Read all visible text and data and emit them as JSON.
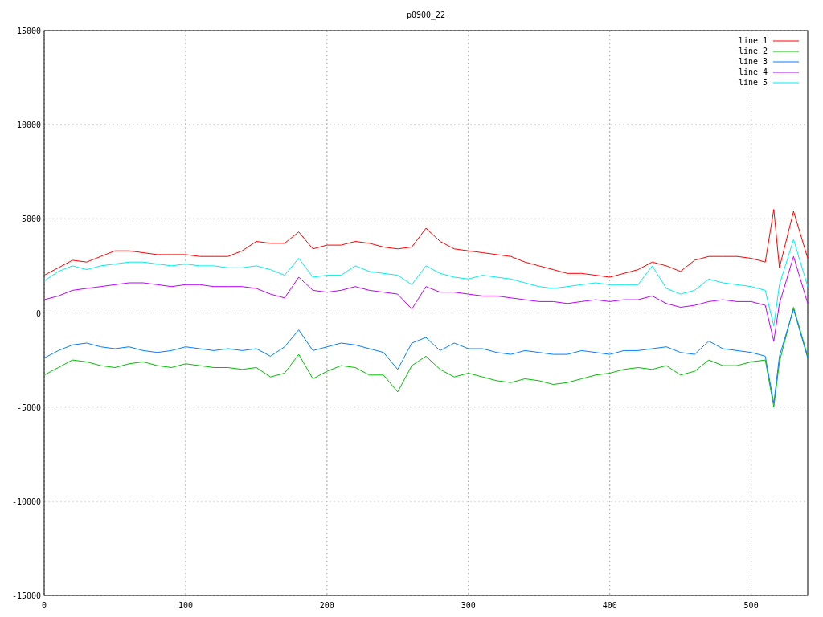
{
  "chart": {
    "chart_data": {
      "type": "line",
      "title": "p0900_22",
      "x": [
        0,
        10,
        20,
        30,
        40,
        50,
        60,
        70,
        80,
        90,
        100,
        110,
        120,
        130,
        140,
        150,
        160,
        170,
        180,
        190,
        200,
        210,
        220,
        230,
        240,
        250,
        260,
        270,
        280,
        290,
        300,
        310,
        320,
        330,
        340,
        350,
        360,
        370,
        380,
        390,
        400,
        410,
        420,
        430,
        440,
        450,
        460,
        470,
        480,
        490,
        500,
        510,
        516,
        520,
        530,
        540
      ],
      "series": [
        {
          "name": "line 1",
          "color": "#ff0000",
          "values": [
            2000,
            2400,
            2800,
            2700,
            3000,
            3300,
            3300,
            3200,
            3100,
            3100,
            3100,
            3000,
            3000,
            3000,
            3300,
            3800,
            3700,
            3700,
            4300,
            3400,
            3600,
            3600,
            3800,
            3700,
            3500,
            3400,
            3500,
            4500,
            3800,
            3400,
            3300,
            3200,
            3100,
            3000,
            2700,
            2500,
            2300,
            2100,
            2100,
            2000,
            1900,
            2100,
            2300,
            2700,
            2500,
            2200,
            2800,
            3000,
            3000,
            3000,
            2900,
            2700,
            5500,
            2400,
            5400,
            2900
          ]
        },
        {
          "name": "line 2",
          "color": "#00c000",
          "values": [
            -3300,
            -2900,
            -2500,
            -2600,
            -2800,
            -2900,
            -2700,
            -2600,
            -2800,
            -2900,
            -2700,
            -2800,
            -2900,
            -2900,
            -3000,
            -2900,
            -3400,
            -3200,
            -2200,
            -3500,
            -3100,
            -2800,
            -2900,
            -3300,
            -3300,
            -4200,
            -2800,
            -2300,
            -3000,
            -3400,
            -3200,
            -3400,
            -3600,
            -3700,
            -3500,
            -3600,
            -3800,
            -3700,
            -3500,
            -3300,
            -3200,
            -3000,
            -2900,
            -3000,
            -2800,
            -3300,
            -3100,
            -2500,
            -2800,
            -2800,
            -2600,
            -2500,
            -5000,
            -2600,
            300,
            -2300
          ]
        },
        {
          "name": "line 3",
          "color": "#0080ff",
          "values": [
            -2400,
            -2000,
            -1700,
            -1600,
            -1800,
            -1900,
            -1800,
            -2000,
            -2100,
            -2000,
            -1800,
            -1900,
            -2000,
            -1900,
            -2000,
            -1900,
            -2300,
            -1800,
            -900,
            -2000,
            -1800,
            -1600,
            -1700,
            -1900,
            -2100,
            -3000,
            -1600,
            -1300,
            -2000,
            -1600,
            -1900,
            -1900,
            -2100,
            -2200,
            -2000,
            -2100,
            -2200,
            -2200,
            -2000,
            -2100,
            -2200,
            -2000,
            -2000,
            -1900,
            -1800,
            -2100,
            -2200,
            -1500,
            -1900,
            -2000,
            -2100,
            -2300,
            -4800,
            -2300,
            200,
            -2400
          ]
        },
        {
          "name": "line 4",
          "color": "#c000ff",
          "values": [
            700,
            900,
            1200,
            1300,
            1400,
            1500,
            1600,
            1600,
            1500,
            1400,
            1500,
            1500,
            1400,
            1400,
            1400,
            1300,
            1000,
            800,
            1900,
            1200,
            1100,
            1200,
            1400,
            1200,
            1100,
            1000,
            200,
            1400,
            1100,
            1100,
            1000,
            900,
            900,
            800,
            700,
            600,
            600,
            500,
            600,
            700,
            600,
            700,
            700,
            900,
            500,
            300,
            400,
            600,
            700,
            600,
            600,
            400,
            -1500,
            500,
            3000,
            500
          ]
        },
        {
          "name": "line 5",
          "color": "#00eeee",
          "values": [
            1700,
            2200,
            2500,
            2300,
            2500,
            2600,
            2700,
            2700,
            2600,
            2500,
            2600,
            2500,
            2500,
            2400,
            2400,
            2500,
            2300,
            2000,
            2900,
            1900,
            2000,
            2000,
            2500,
            2200,
            2100,
            2000,
            1500,
            2500,
            2100,
            1900,
            1800,
            2000,
            1900,
            1800,
            1600,
            1400,
            1300,
            1400,
            1500,
            1600,
            1500,
            1500,
            1500,
            2500,
            1300,
            1000,
            1200,
            1800,
            1600,
            1500,
            1400,
            1200,
            -700,
            1500,
            3900,
            1400
          ]
        }
      ],
      "xlim": [
        0,
        540
      ],
      "ylim": [
        -15000,
        15000
      ],
      "xticks": [
        0,
        100,
        200,
        300,
        400,
        500
      ],
      "yticks": [
        -15000,
        -10000,
        -5000,
        0,
        5000,
        10000,
        15000
      ],
      "grid": true,
      "legend": true
    }
  }
}
